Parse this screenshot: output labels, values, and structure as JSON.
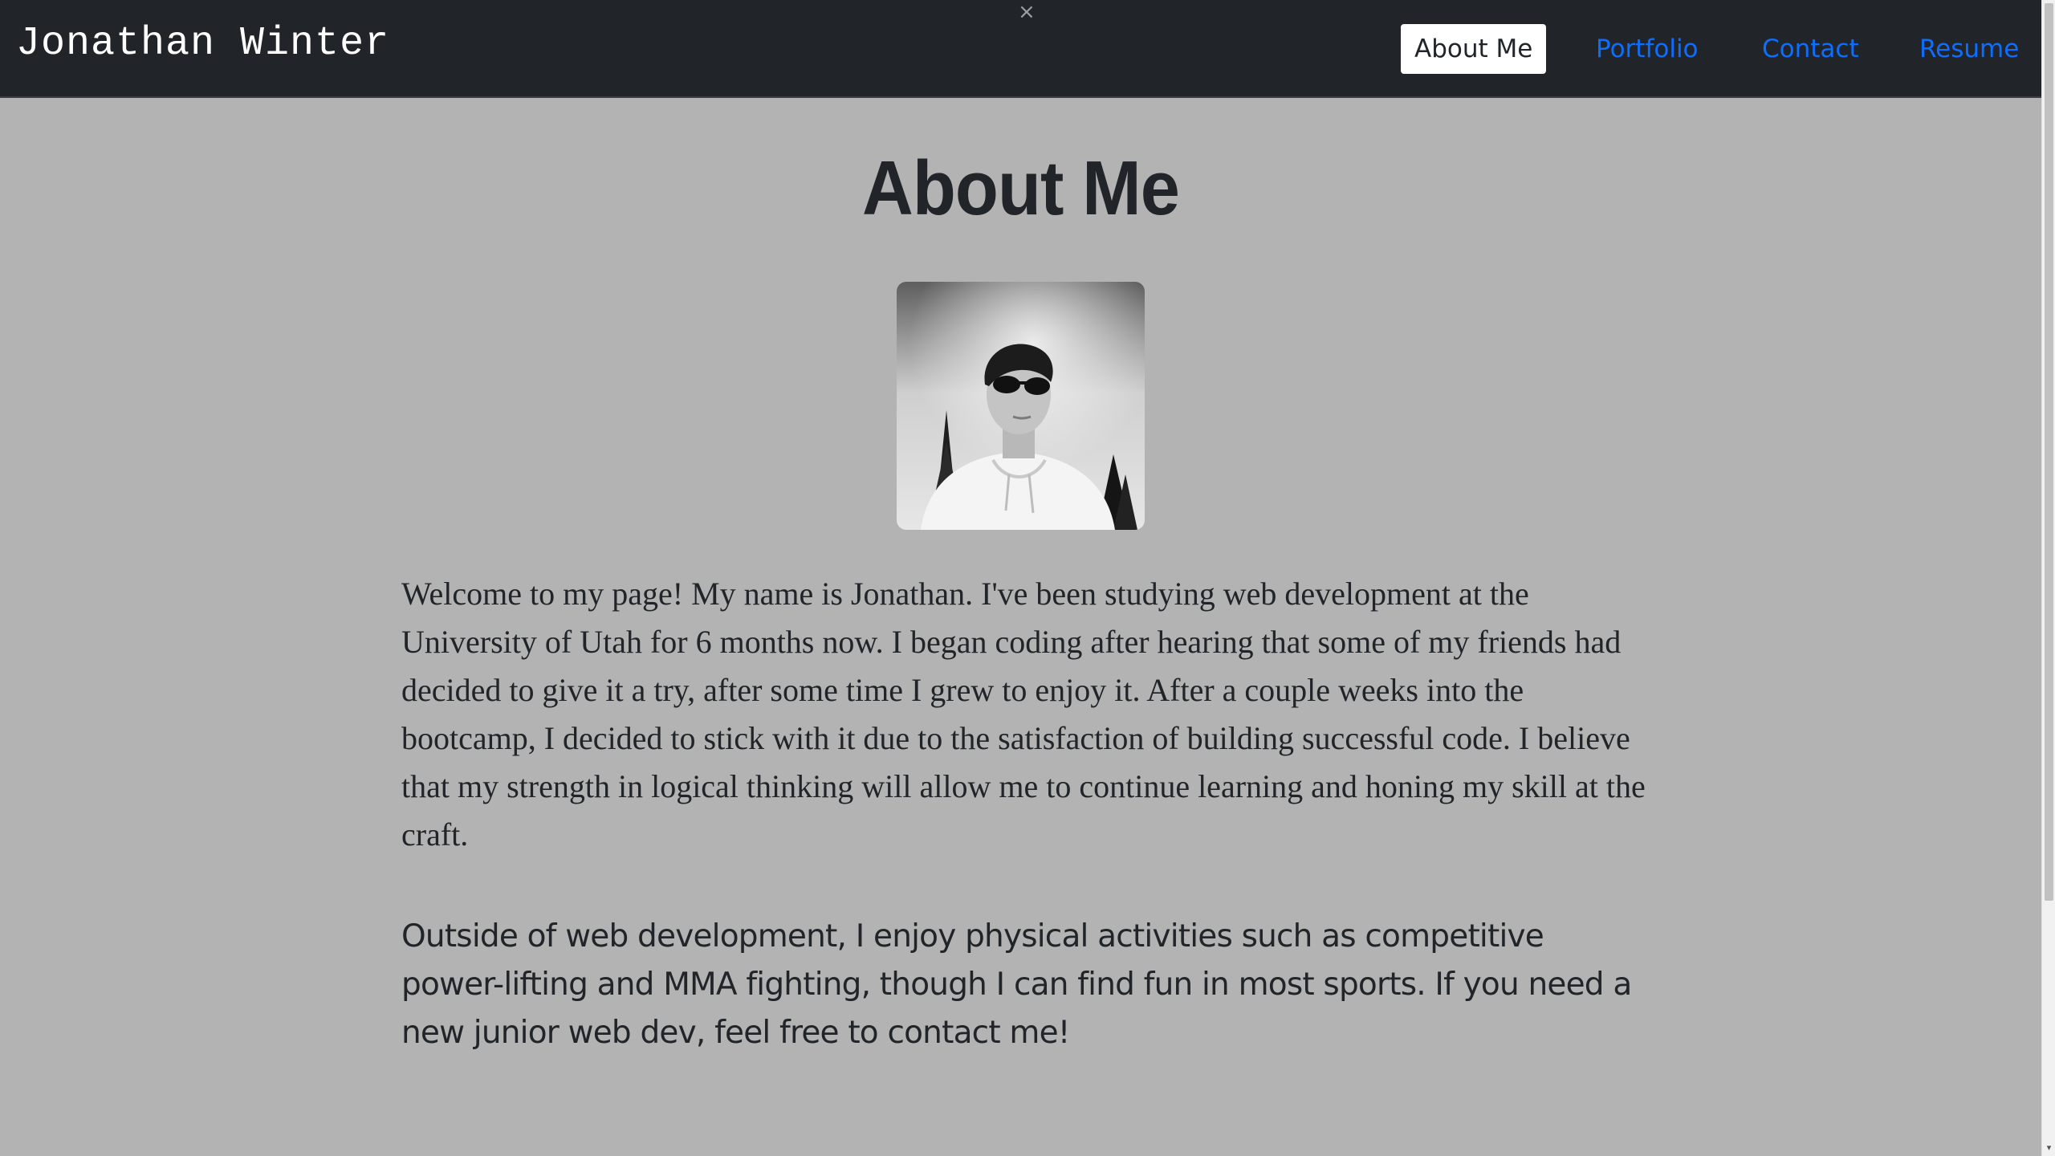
{
  "header": {
    "brand": "Jonathan Winter",
    "close_glyph": "×",
    "nav": [
      {
        "label": "About Me",
        "active": true
      },
      {
        "label": "Portfolio",
        "active": false
      },
      {
        "label": "Contact",
        "active": false
      },
      {
        "label": "Resume",
        "active": false
      }
    ]
  },
  "main": {
    "title": "About Me",
    "avatar_icon": "profile-photo",
    "paragraphs": [
      "Welcome to my page! My name is Jonathan. I've been studying web development at the University of Utah for 6 months now. I began coding after hearing that some of my friends had decided to give it a try, after some time I grew to enjoy it. After a couple weeks into the bootcamp, I decided to stick with it due to the satisfaction of building successful code. I believe that my strength in logical thinking will allow me to continue learning and honing my skill at the craft.",
      "Outside of web development, I enjoy physical activities such as competitive power-lifting and MMA fighting, though I can find fun in most sports. If you need a new junior web dev, feel free to contact me!"
    ]
  },
  "colors": {
    "navbar_bg": "#212529",
    "page_bg": "#b3b3b3",
    "link": "#0d6efd",
    "text": "#212529"
  },
  "scrollbar": {
    "arrow_glyph": "▾"
  }
}
